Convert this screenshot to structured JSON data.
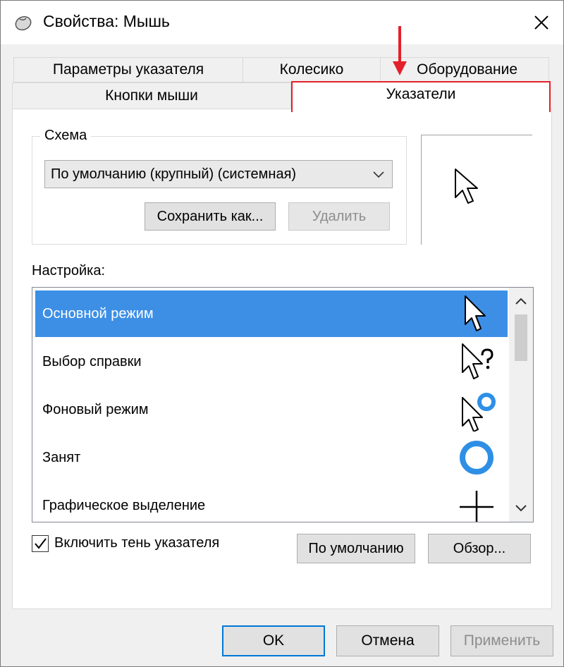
{
  "window": {
    "title": "Свойства: Мышь",
    "icon": "mouse-icon",
    "close_icon": "close-icon"
  },
  "tabs": {
    "row1": [
      {
        "label": "Параметры указателя"
      },
      {
        "label": "Колесико"
      },
      {
        "label": "Оборудование"
      }
    ],
    "row2": [
      {
        "label": "Кнопки мыши"
      },
      {
        "label": "Указатели",
        "active": true
      }
    ]
  },
  "scheme": {
    "group_label": "Схема",
    "selected": "По умолчанию (крупный) (системная)",
    "save_as_label": "Сохранить как...",
    "delete_label": "Удалить"
  },
  "customize": {
    "label": "Настройка:",
    "items": [
      {
        "label": "Основной режим",
        "icon": "arrow-pointer-icon",
        "selected": true
      },
      {
        "label": "Выбор справки",
        "icon": "help-select-pointer-icon"
      },
      {
        "label": "Фоновый режим",
        "icon": "working-in-background-pointer-icon"
      },
      {
        "label": "Занят",
        "icon": "busy-ring-icon"
      },
      {
        "label": "Графическое выделение",
        "icon": "crosshair-icon"
      }
    ]
  },
  "shadow_checkbox": {
    "label": "Включить тень указателя",
    "checked": true
  },
  "buttons": {
    "default_label": "По умолчанию",
    "browse_label": "Обзор..."
  },
  "footer": {
    "ok_label": "OK",
    "cancel_label": "Отмена",
    "apply_label": "Применить"
  },
  "colors": {
    "selection": "#3d8fe6",
    "annotation": "#e3202a",
    "busy_ring": "#2e8fe6"
  }
}
